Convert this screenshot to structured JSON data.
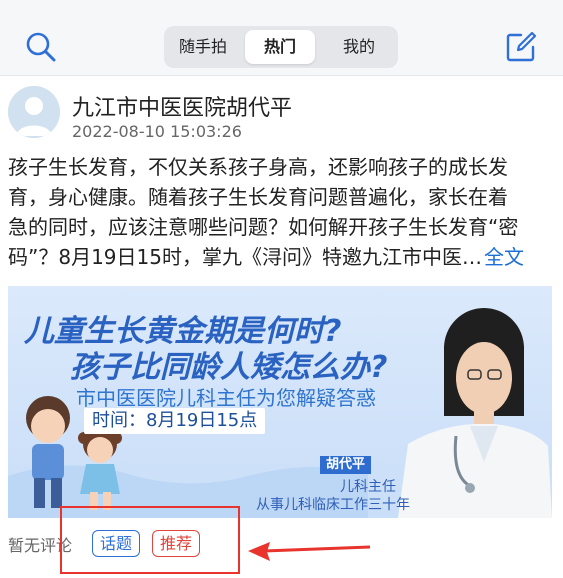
{
  "header": {
    "tabs": [
      {
        "label": "随手拍"
      },
      {
        "label": "热门",
        "active": true
      },
      {
        "label": "我的"
      }
    ],
    "search_icon": "search-icon",
    "compose_icon": "edit-icon"
  },
  "post": {
    "author": "九江市中医医院胡代平",
    "time": "2022-08-10 15:03:26",
    "text_lines": [
      "孩子生长发育，不仅关系孩子身高，还影响孩子的成长发",
      "育，身心健康。随着孩子生长发育问题普遍化，家长在着",
      "急的同时，应该注意哪些问题？如何解开孩子生长发育“密",
      "码”？8月19日15时，掌九《浔问》特邀九江市中医…"
    ],
    "more_label": "全文",
    "banner": {
      "title_line1": "儿童生长黄金期是何时?",
      "title_line2": "孩子比同龄人矮怎么办?",
      "subtitle": "市中医医院儿科主任为您解疑答惑",
      "time": "时间：8月19日15点",
      "doctor_name": "胡代平",
      "doctor_role": "儿科主任",
      "doctor_exp": "从事儿科临床工作三十年"
    },
    "comment_status": "暂无评论",
    "tags": [
      "话题",
      "推荐"
    ]
  },
  "colors": {
    "accent_blue": "#2f6fd8",
    "tag_red": "#e0463c",
    "annotation_red": "#e8342c"
  }
}
